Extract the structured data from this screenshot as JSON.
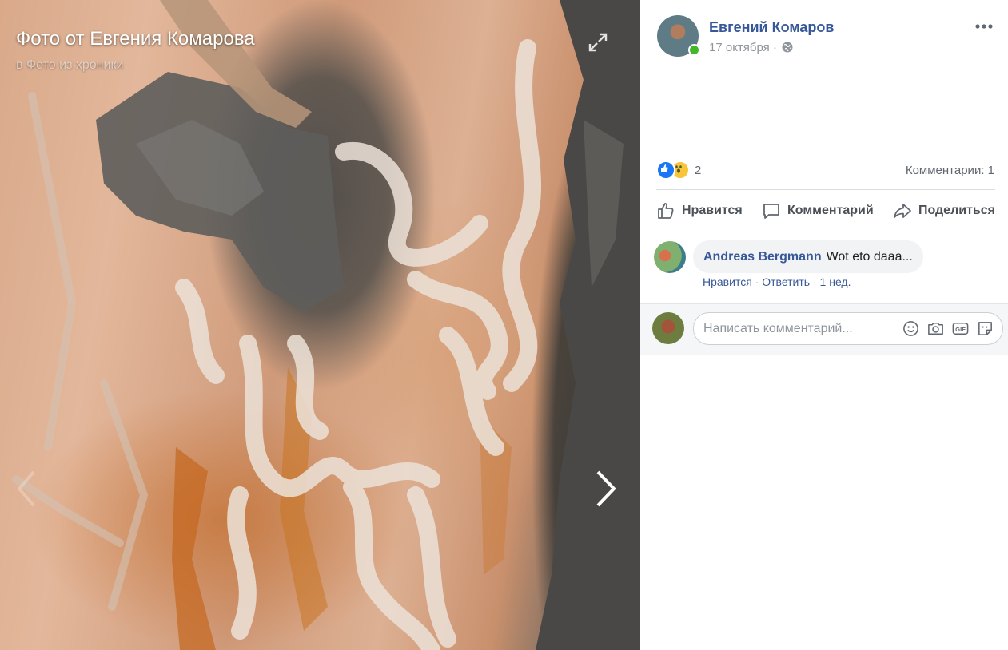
{
  "photo": {
    "title": "Фото от Евгения Комарова",
    "album_link": "в Фото из хроники",
    "icons": {
      "expand": "expand-icon",
      "prev": "chevron-left-icon",
      "next": "chevron-right-icon"
    }
  },
  "post": {
    "author": "Евгений Комаров",
    "date": "17 октября",
    "separator": "·",
    "privacy_icon": "globe-icon",
    "more_icon": "more-options-icon",
    "reactions": {
      "types": [
        "like",
        "wow"
      ],
      "count": "2"
    },
    "comments_count": "Комментарии: 1"
  },
  "actions": {
    "like": "Нравится",
    "comment": "Комментарий",
    "share": "Поделиться"
  },
  "comment": {
    "author": "Andreas Bergmann",
    "text": "Wot eto daaa...",
    "like": "Нравится",
    "reply": "Ответить",
    "time": "1 нед.",
    "separator": "·"
  },
  "composer": {
    "placeholder": "Написать комментарий...",
    "icons": [
      "emoji-icon",
      "camera-icon",
      "gif-icon",
      "sticker-icon"
    ]
  },
  "colors": {
    "link": "#385898",
    "online": "#42b72a",
    "like_blue": "#1877f2",
    "wow_yellow": "#f7c538"
  }
}
